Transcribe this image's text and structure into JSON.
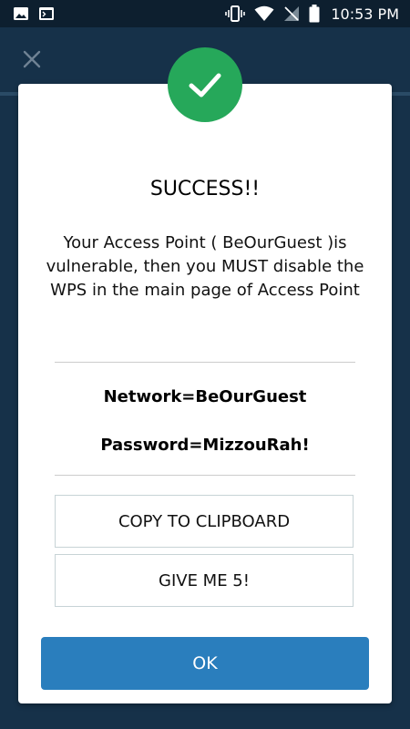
{
  "status_bar": {
    "time": "10:53 PM",
    "left_icons": [
      "image-icon",
      "terminal-icon"
    ],
    "right_icons": [
      "vibrate-icon",
      "wifi-icon",
      "no-signal-icon",
      "battery-icon"
    ]
  },
  "toolbar": {
    "close_icon": "close-icon"
  },
  "dialog": {
    "badge_icon": "checkmark-icon",
    "title": "SUCCESS!!",
    "message": "Your Access Point ( BeOurGuest )is vulnerable, then you MUST disable the WPS in the main page of Access Point",
    "network": "Network=BeOurGuest",
    "password": "Password=MizzouRah!",
    "copy_button": "COPY TO CLIPBOARD",
    "give5_button": "GIVE ME 5!",
    "ok_button": "OK"
  },
  "colors": {
    "background": "#163149",
    "success_green": "#26a85a",
    "ok_blue": "#2a7ebd"
  }
}
